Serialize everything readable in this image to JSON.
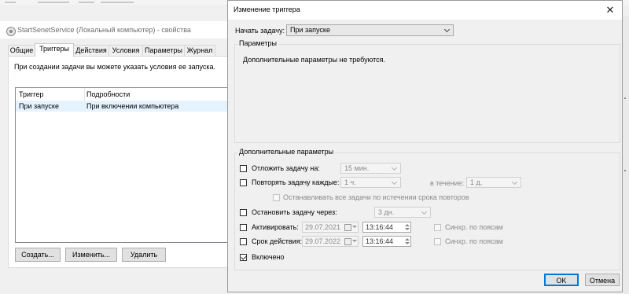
{
  "background_window": {
    "title": "StartSenetService (Локальный компьютер) - свойства",
    "tabs": [
      "Общие",
      "Триггеры",
      "Действия",
      "Условия",
      "Параметры",
      "Журнал"
    ],
    "active_tab": "Триггеры",
    "description": "При создании задачи вы можете указать условия ее запуска.",
    "trigger_table": {
      "columns": [
        "Триггер",
        "Подробности"
      ],
      "rows": [
        {
          "trigger": "При запуске",
          "details": "При включении компьютера"
        }
      ]
    },
    "buttons": {
      "create": "Создать...",
      "edit": "Изменить...",
      "delete": "Удалить"
    }
  },
  "dialog": {
    "title": "Изменение триггера",
    "close_icon": "close-icon",
    "start_task_label": "Начать задачу:",
    "start_task_value": "При запуске",
    "parameters_group": "Параметры",
    "parameters_text": "Дополнительные параметры не требуются.",
    "advanced_group": "Дополнительные параметры",
    "delay": {
      "label": "Отложить задачу на:",
      "value": "15 мин.",
      "checked": false
    },
    "repeat": {
      "label": "Повторять задачу каждые:",
      "value": "1 ч.",
      "duration_label": "в течение:",
      "duration_value": "1 д.",
      "checked": false
    },
    "stop_all": {
      "label": "Останавливать все задачи по истечении срока повторов",
      "checked": false
    },
    "stop_after": {
      "label": "Остановить задачу через:",
      "value": "3 дн.",
      "checked": false
    },
    "activate": {
      "label": "Активировать:",
      "date": "29.07.2021",
      "time": "13:16:44",
      "sync_label": "Синхр. по поясам",
      "checked": false
    },
    "expire": {
      "label": "Срок действия:",
      "date": "29.07.2022",
      "time": "13:16:44",
      "sync_label": "Синхр. по поясам",
      "checked": false
    },
    "enabled": {
      "label": "Включено",
      "checked": true
    },
    "ok_label": "OK",
    "cancel_label": "Отмена"
  },
  "colors": {
    "accent": "#0078d7",
    "selection": "#e5f3ff"
  }
}
